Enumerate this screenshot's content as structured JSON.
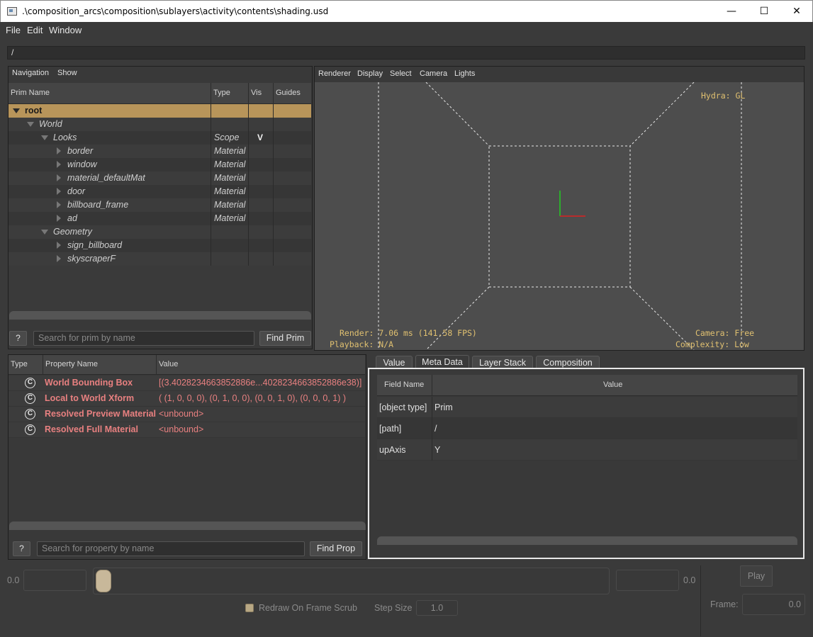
{
  "window": {
    "title": ".\\composition_arcs\\composition\\sublayers\\activity\\contents\\shading.usd",
    "minimize_glyph": "—",
    "maximize_glyph": "☐",
    "close_glyph": "✕"
  },
  "menu": [
    "File",
    "Edit",
    "Window"
  ],
  "path_bar": {
    "value": "/"
  },
  "prim_panel": {
    "toolbar": [
      "Navigation",
      "Show"
    ],
    "columns": [
      "Prim Name",
      "Type",
      "Vis",
      "Guides"
    ],
    "rows": [
      {
        "name": "root",
        "type": "",
        "vis": ""
      },
      {
        "name": "World",
        "type": "",
        "vis": ""
      },
      {
        "name": "Looks",
        "type": "Scope",
        "vis": "V"
      },
      {
        "name": "border",
        "type": "Material",
        "vis": ""
      },
      {
        "name": "window",
        "type": "Material",
        "vis": ""
      },
      {
        "name": "material_defaultMat",
        "type": "Material",
        "vis": ""
      },
      {
        "name": "door",
        "type": "Material",
        "vis": ""
      },
      {
        "name": "billboard_frame",
        "type": "Material",
        "vis": ""
      },
      {
        "name": "ad",
        "type": "Material",
        "vis": ""
      },
      {
        "name": "Geometry",
        "type": "",
        "vis": ""
      },
      {
        "name": "sign_billboard",
        "type": "",
        "vis": ""
      },
      {
        "name": "skyscraperF",
        "type": "",
        "vis": ""
      }
    ],
    "help_label": "?",
    "search_placeholder": "Search for prim by name",
    "find_label": "Find Prim"
  },
  "viewport": {
    "toolbar": [
      "Renderer",
      "Display",
      "Select",
      "Camera",
      "Lights"
    ],
    "hud_renderer": "Hydra: GL",
    "hud_render": "Render: 7.06 ms (141.58 FPS)",
    "hud_playback": "Playback: N/A",
    "hud_camera": "Camera: Free",
    "hud_complexity": "Complexity: Low"
  },
  "property_panel": {
    "columns": [
      "Type",
      "Property Name",
      "Value"
    ],
    "type_glyph": "C",
    "rows": [
      {
        "name": "World Bounding Box",
        "value": "[(3.4028234663852886e...4028234663852886e38)]"
      },
      {
        "name": "Local to World Xform",
        "value": "( (1, 0, 0, 0), (0, 1, 0, 0), (0, 0, 1, 0), (0, 0, 0, 1) )"
      },
      {
        "name": "Resolved Preview Material",
        "value": "<unbound>"
      },
      {
        "name": "Resolved Full Material",
        "value": "<unbound>"
      }
    ],
    "help_label": "?",
    "search_placeholder": "Search for property by name",
    "find_label": "Find Prop"
  },
  "inspector": {
    "tabs": [
      "Value",
      "Meta Data",
      "Layer Stack",
      "Composition"
    ],
    "active_tab": "Meta Data",
    "columns": [
      "Field Name",
      "Value"
    ],
    "rows": [
      {
        "field": "[object type]",
        "value": "Prim"
      },
      {
        "field": "[path]",
        "value": "/"
      },
      {
        "field": "upAxis",
        "value": "Y"
      }
    ]
  },
  "timeline": {
    "start_label": "0.0",
    "end_label": "0.0",
    "play_label": "Play",
    "redraw_label": "Redraw On Frame Scrub",
    "step_label": "Step Size",
    "step_value": "1.0",
    "frame_label": "Frame:",
    "frame_value": "0.0"
  },
  "colors": {
    "selected_row": "#b8955a",
    "property_text": "#e88080",
    "hud_text": "#e0c070",
    "active_border": "#e8e8e8"
  }
}
